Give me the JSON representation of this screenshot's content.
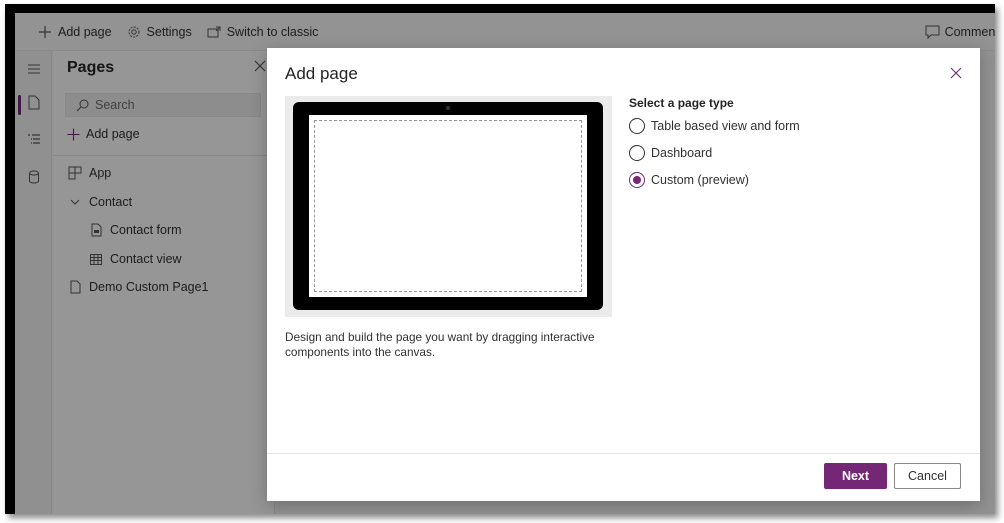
{
  "commandbar": {
    "add_page": "Add page",
    "settings": "Settings",
    "switch_classic": "Switch to classic",
    "comments": "Comments"
  },
  "rail": {
    "items": [
      {
        "icon": "hamburger-icon"
      },
      {
        "icon": "page-icon",
        "active": true
      },
      {
        "icon": "tree-view-icon"
      },
      {
        "icon": "database-icon"
      }
    ]
  },
  "pages_pane": {
    "title": "Pages",
    "search_placeholder": "Search",
    "add_page": "Add page",
    "tree": [
      {
        "label": "App",
        "icon": "app-grid-icon",
        "level": 0
      },
      {
        "label": "Contact",
        "icon": "chevron-down-icon",
        "level": 0,
        "expanded": true
      },
      {
        "label": "Contact form",
        "icon": "form-icon",
        "level": 1
      },
      {
        "label": "Contact view",
        "icon": "table-icon",
        "level": 1
      },
      {
        "label": "Demo Custom Page1",
        "icon": "page-icon",
        "level": 0
      }
    ]
  },
  "dialog": {
    "title": "Add page",
    "description": "Design and build the page you want by dragging interactive components into the canvas.",
    "page_type_label": "Select a page type",
    "options": [
      {
        "label": "Table based view and form",
        "selected": false
      },
      {
        "label": "Dashboard",
        "selected": false
      },
      {
        "label": "Custom (preview)",
        "selected": true
      }
    ],
    "next_label": "Next",
    "cancel_label": "Cancel"
  },
  "colors": {
    "accent": "#742774",
    "overlay": "rgba(0,0,0,0.40)"
  }
}
